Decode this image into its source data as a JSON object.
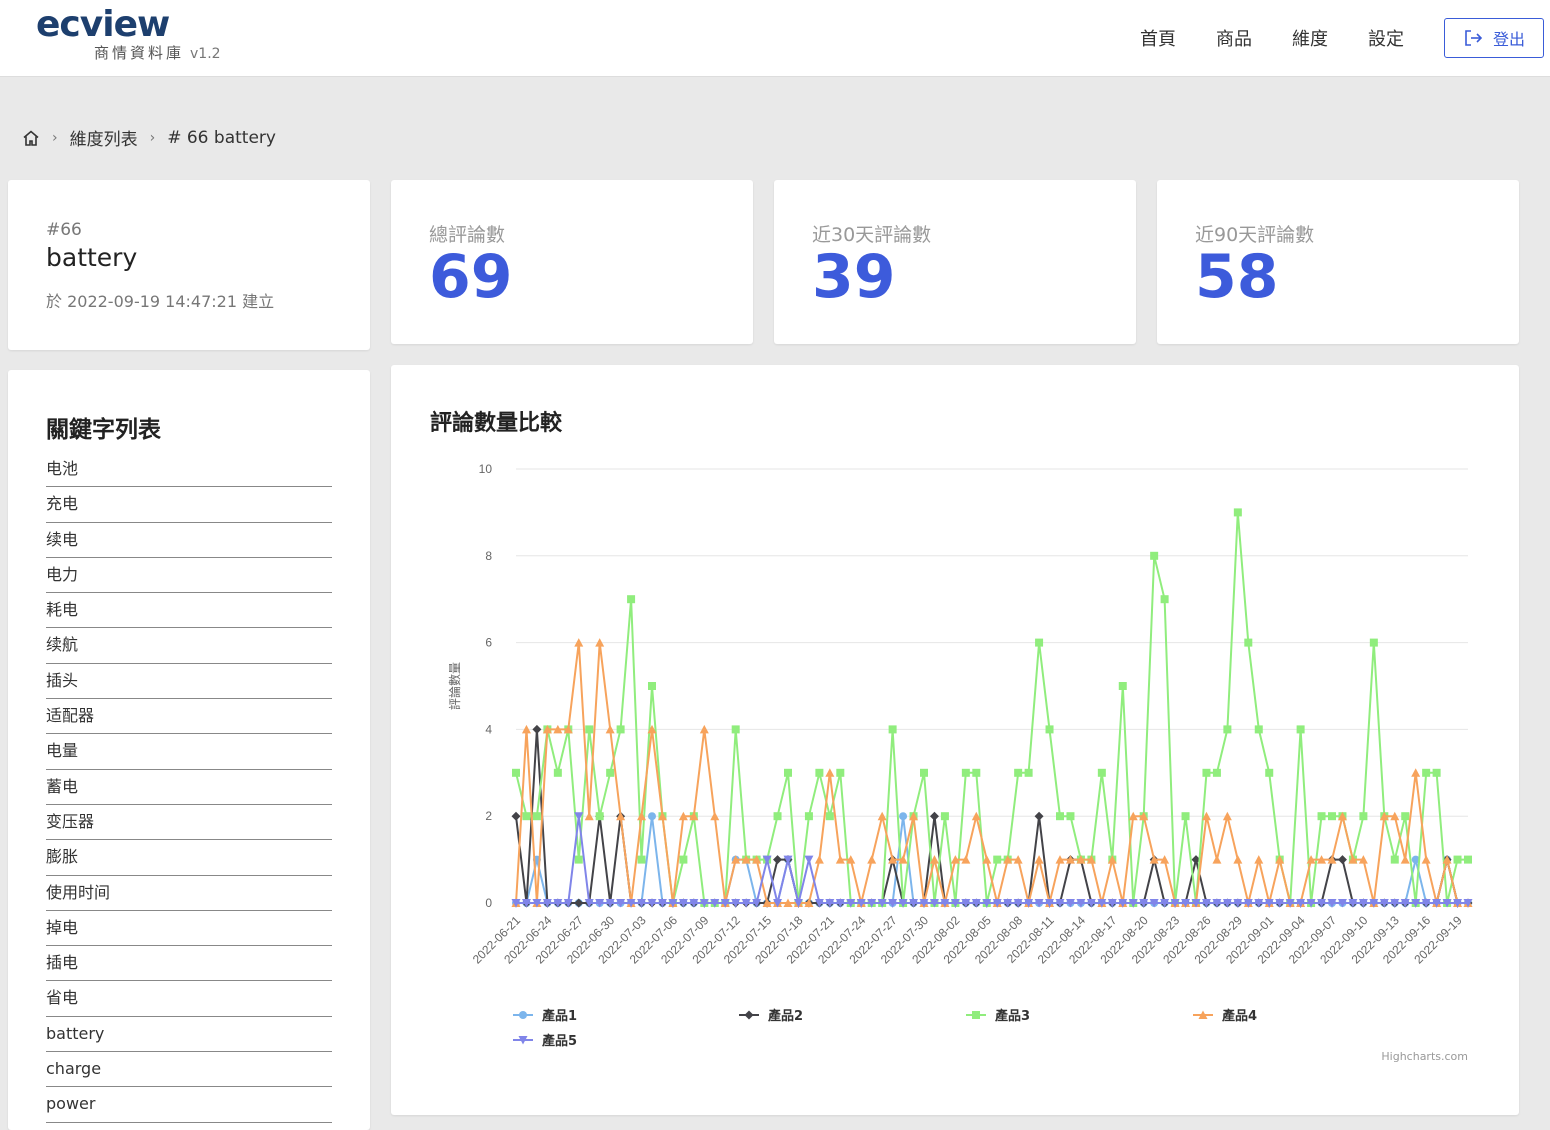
{
  "header": {
    "logo_text": "ecview",
    "logo_subtitle": "商情資料庫",
    "version": "v1.2",
    "nav": [
      "首頁",
      "商品",
      "維度",
      "設定"
    ],
    "logout_label": "登出"
  },
  "breadcrumb": {
    "items": [
      "維度列表",
      "# 66 battery"
    ]
  },
  "dimension": {
    "id_label": "#66",
    "name": "battery",
    "created": "於 2022-09-19 14:47:21 建立"
  },
  "stats": [
    {
      "label": "總評論數",
      "value": "69"
    },
    {
      "label": "近30天評論數",
      "value": "39"
    },
    {
      "label": "近90天評論數",
      "value": "58"
    }
  ],
  "keywords": {
    "title": "關鍵字列表",
    "items": [
      "电池",
      "充电",
      "续电",
      "电力",
      "耗电",
      "续航",
      "插头",
      "适配器",
      "电量",
      "蓄电",
      "变压器",
      "膨胀",
      "使用时间",
      "掉电",
      "插电",
      "省电",
      "battery",
      "charge",
      "power"
    ]
  },
  "chart_data": {
    "type": "line",
    "title": "評論數量比較",
    "ylabel": "評論數量",
    "xlabel": "",
    "ylim": [
      0,
      10
    ],
    "yticks": [
      0,
      2,
      4,
      6,
      8,
      10
    ],
    "grid": true,
    "legend_position": "bottom",
    "credit": "Highcharts.com",
    "x_start": "2022-06-21",
    "x_end": "2022-09-20",
    "x_tick_labels": [
      "2022-06-21",
      "2022-06-24",
      "2022-06-27",
      "2022-06-30",
      "2022-07-03",
      "2022-07-06",
      "2022-07-09",
      "2022-07-12",
      "2022-07-15",
      "2022-07-18",
      "2022-07-21",
      "2022-07-24",
      "2022-07-27",
      "2022-07-30",
      "2022-08-02",
      "2022-08-05",
      "2022-08-08",
      "2022-08-11",
      "2022-08-14",
      "2022-08-17",
      "2022-08-20",
      "2022-08-23",
      "2022-08-26",
      "2022-08-29",
      "2022-09-01",
      "2022-09-04",
      "2022-09-07",
      "2022-09-10",
      "2022-09-13",
      "2022-09-16",
      "2022-09-19"
    ],
    "series": [
      {
        "name": "產品1",
        "color": "#7cb5ec",
        "marker": "circle",
        "values": [
          0,
          0,
          1,
          0,
          0,
          0,
          0,
          0,
          0,
          0,
          0,
          0,
          0,
          2,
          0,
          0,
          0,
          0,
          0,
          0,
          0,
          1,
          1,
          0,
          0,
          0,
          1,
          0,
          0,
          0,
          0,
          0,
          0,
          0,
          0,
          0,
          0,
          2,
          0,
          0,
          0,
          0,
          0,
          0,
          0,
          0,
          0,
          0,
          0,
          0,
          0,
          0,
          0,
          0,
          0,
          0,
          0,
          0,
          0,
          0,
          0,
          0,
          0,
          0,
          0,
          0,
          0,
          0,
          0,
          0,
          0,
          0,
          0,
          0,
          0,
          0,
          0,
          0,
          0,
          0,
          0,
          0,
          0,
          0,
          0,
          0,
          1,
          0,
          0,
          1,
          0,
          0
        ]
      },
      {
        "name": "產品2",
        "color": "#434348",
        "marker": "diamond",
        "values": [
          2,
          0,
          4,
          0,
          0,
          0,
          0,
          0,
          2,
          0,
          2,
          0,
          0,
          0,
          0,
          0,
          0,
          0,
          0,
          0,
          0,
          0,
          0,
          0,
          0,
          1,
          1,
          0,
          0,
          0,
          0,
          0,
          0,
          0,
          0,
          0,
          1,
          0,
          0,
          0,
          2,
          0,
          0,
          0,
          0,
          0,
          0,
          0,
          0,
          0,
          2,
          0,
          0,
          1,
          1,
          0,
          0,
          0,
          0,
          0,
          0,
          1,
          0,
          0,
          0,
          1,
          0,
          0,
          0,
          0,
          0,
          0,
          0,
          0,
          0,
          0,
          0,
          0,
          1,
          1,
          0,
          0,
          0,
          0,
          0,
          0,
          0,
          0,
          0,
          1,
          0,
          0
        ]
      },
      {
        "name": "產品3",
        "color": "#90ed7d",
        "marker": "square",
        "values": [
          3,
          2,
          2,
          4,
          3,
          4,
          1,
          4,
          2,
          3,
          4,
          7,
          1,
          5,
          2,
          0,
          1,
          2,
          0,
          0,
          0,
          4,
          1,
          1,
          1,
          2,
          3,
          0,
          2,
          3,
          2,
          3,
          0,
          0,
          0,
          0,
          4,
          0,
          2,
          3,
          0,
          2,
          0,
          3,
          3,
          0,
          1,
          1,
          3,
          3,
          6,
          4,
          2,
          2,
          1,
          1,
          3,
          1,
          5,
          0,
          2,
          8,
          7,
          0,
          2,
          0,
          3,
          3,
          4,
          9,
          6,
          4,
          3,
          1,
          0,
          4,
          0,
          2,
          2,
          2,
          1,
          2,
          6,
          2,
          1,
          2,
          0,
          3,
          3,
          0,
          1,
          1
        ]
      },
      {
        "name": "產品4",
        "color": "#f7a35c",
        "marker": "triangle",
        "values": [
          0,
          4,
          0,
          4,
          4,
          4,
          6,
          2,
          6,
          4,
          2,
          0,
          2,
          4,
          2,
          0,
          2,
          2,
          4,
          2,
          0,
          1,
          1,
          1,
          0,
          0,
          0,
          0,
          0,
          1,
          3,
          1,
          1,
          0,
          1,
          2,
          1,
          1,
          2,
          0,
          1,
          0,
          1,
          1,
          2,
          1,
          0,
          1,
          1,
          0,
          1,
          0,
          1,
          1,
          1,
          1,
          0,
          1,
          0,
          2,
          2,
          1,
          1,
          0,
          0,
          0,
          2,
          1,
          2,
          1,
          0,
          1,
          0,
          1,
          0,
          0,
          1,
          1,
          1,
          2,
          1,
          1,
          0,
          2,
          2,
          1,
          3,
          1,
          0,
          1,
          0,
          0
        ]
      },
      {
        "name": "產品5",
        "color": "#8085e9",
        "marker": "triangle-down",
        "values": [
          0,
          0,
          0,
          0,
          0,
          0,
          2,
          0,
          0,
          0,
          0,
          0,
          0,
          0,
          0,
          0,
          0,
          0,
          0,
          0,
          0,
          0,
          0,
          0,
          1,
          0,
          1,
          0,
          1,
          0,
          0,
          0,
          0,
          0,
          0,
          0,
          0,
          0,
          0,
          0,
          0,
          0,
          0,
          0,
          0,
          0,
          0,
          0,
          0,
          0,
          0,
          0,
          0,
          0,
          0,
          0,
          0,
          0,
          0,
          0,
          0,
          0,
          0,
          0,
          0,
          0,
          0,
          0,
          0,
          0,
          0,
          0,
          0,
          0,
          0,
          0,
          0,
          0,
          0,
          0,
          0,
          0,
          0,
          0,
          0,
          0,
          0,
          0,
          0,
          0,
          0,
          0
        ]
      }
    ]
  }
}
